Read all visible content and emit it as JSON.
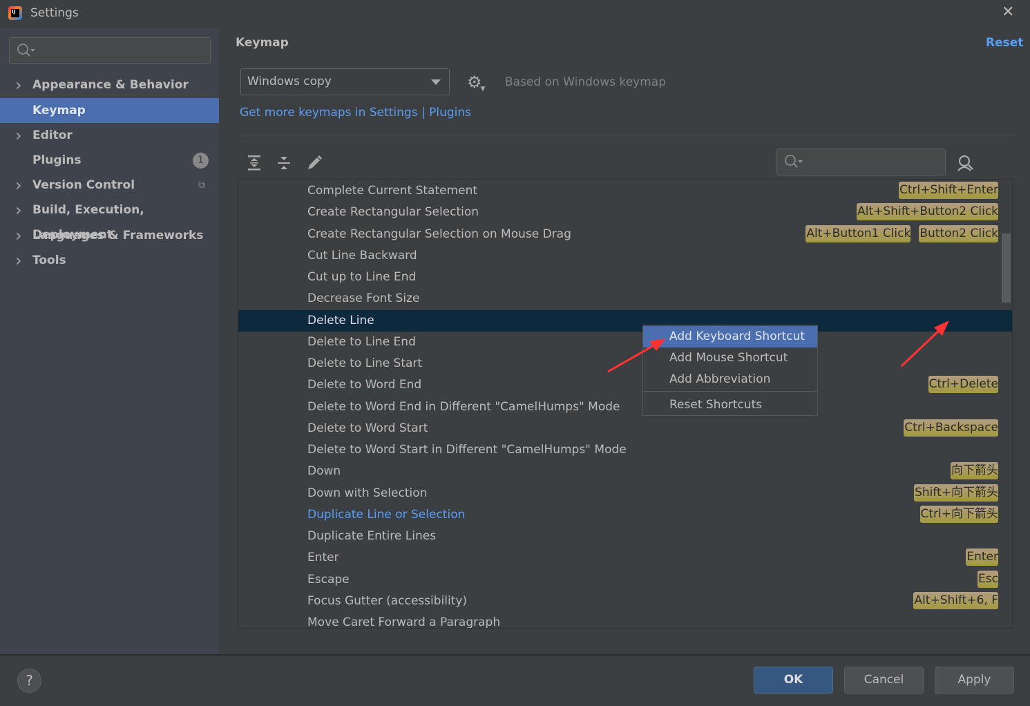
{
  "window": {
    "title": "Settings",
    "close_icon": "close-icon"
  },
  "sidebar": {
    "items": [
      {
        "label": "Appearance & Behavior",
        "expandable": true
      },
      {
        "label": "Keymap",
        "selected": true
      },
      {
        "label": "Editor",
        "expandable": true
      },
      {
        "label": "Plugins",
        "badge": "1"
      },
      {
        "label": "Version Control",
        "expandable": true
      },
      {
        "label": "Build, Execution, Deployment",
        "expandable": true
      },
      {
        "label": "Languages & Frameworks",
        "expandable": true
      },
      {
        "label": "Tools",
        "expandable": true
      }
    ]
  },
  "main": {
    "title": "Keymap",
    "reset_label": "Reset",
    "keymap_value": "Windows copy",
    "based_on": "Based on Windows keymap",
    "plugins_link": "Get more keymaps in Settings | Plugins"
  },
  "actions": [
    {
      "name": "Complete Current Statement",
      "shortcuts": [
        "Ctrl+Shift+Enter"
      ]
    },
    {
      "name": "Create Rectangular Selection",
      "shortcuts": [
        "Alt+Shift+Button2 Click"
      ]
    },
    {
      "name": "Create Rectangular Selection on Mouse Drag",
      "shortcuts": [
        "Alt+Button1 Click",
        "Button2 Click"
      ]
    },
    {
      "name": "Cut Line Backward",
      "shortcuts": []
    },
    {
      "name": "Cut up to Line End",
      "shortcuts": []
    },
    {
      "name": "Decrease Font Size",
      "shortcuts": []
    },
    {
      "name": "Delete Line",
      "shortcuts": [],
      "selected": true
    },
    {
      "name": "Delete to Line End",
      "shortcuts": []
    },
    {
      "name": "Delete to Line Start",
      "shortcuts": []
    },
    {
      "name": "Delete to Word End",
      "shortcuts": [
        "Ctrl+Delete"
      ]
    },
    {
      "name": "Delete to Word End in Different \"CamelHumps\" Mode",
      "shortcuts": []
    },
    {
      "name": "Delete to Word Start",
      "shortcuts": [
        "Ctrl+Backspace"
      ]
    },
    {
      "name": "Delete to Word Start in Different \"CamelHumps\" Mode",
      "shortcuts": []
    },
    {
      "name": "Down",
      "shortcuts": [
        "向下箭头"
      ]
    },
    {
      "name": "Down with Selection",
      "shortcuts": [
        "Shift+向下箭头"
      ]
    },
    {
      "name": "Duplicate Line or Selection",
      "shortcuts": [
        "Ctrl+向下箭头"
      ],
      "modified": true
    },
    {
      "name": "Duplicate Entire Lines",
      "shortcuts": []
    },
    {
      "name": "Enter",
      "shortcuts": [
        "Enter"
      ]
    },
    {
      "name": "Escape",
      "shortcuts": [
        "Esc"
      ]
    },
    {
      "name": "Focus Gutter (accessibility)",
      "shortcuts": [
        "Alt+Shift+6, F"
      ]
    },
    {
      "name": "Move Caret Forward a Paragraph",
      "shortcuts": []
    }
  ],
  "context_menu": {
    "items": [
      "Add Keyboard Shortcut",
      "Add Mouse Shortcut",
      "Add Abbreviation",
      "Reset Shortcuts"
    ],
    "highlighted": "Add Keyboard Shortcut"
  },
  "footer": {
    "help": "?",
    "ok": "OK",
    "cancel": "Cancel",
    "apply": "Apply"
  },
  "colors": {
    "accent": "#4b6eaf",
    "link": "#589df6",
    "selected_row": "#0d293e",
    "annotation_arrow": "#ff3333"
  }
}
